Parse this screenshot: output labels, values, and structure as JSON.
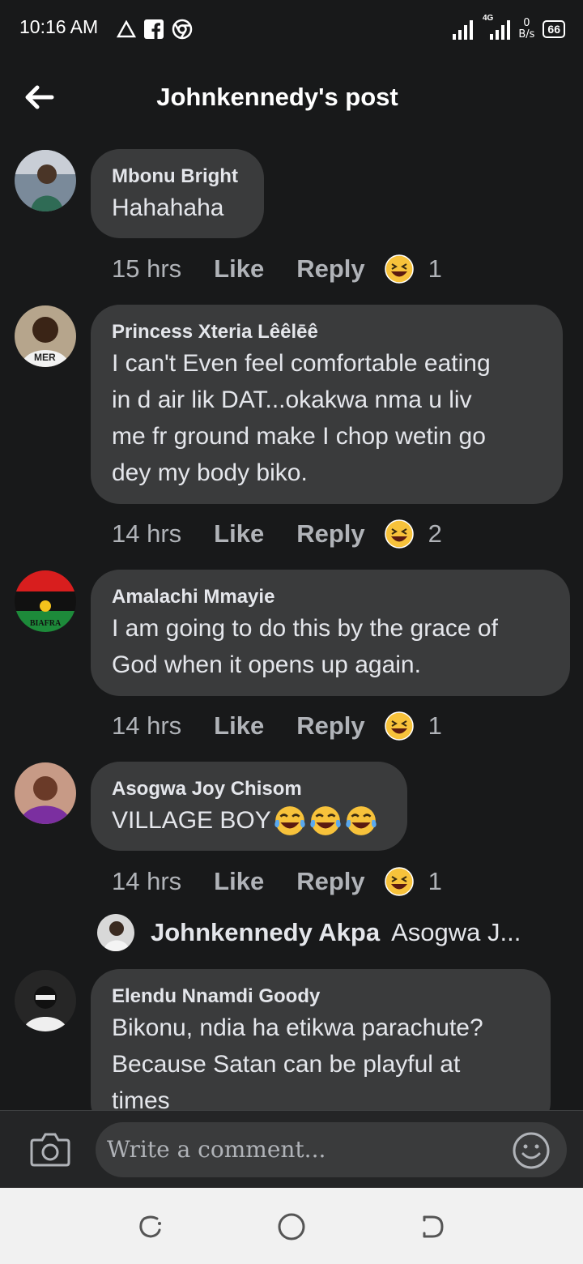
{
  "status_bar": {
    "time": "10:16 AM",
    "network": "4G",
    "speed_value": "0",
    "speed_unit": "B/s",
    "battery": "66"
  },
  "header": {
    "title": "Johnkennedy's post"
  },
  "comments": [
    {
      "name": "Mbonu Bright",
      "lines": [
        "Hahahaha"
      ],
      "time": "15 hrs",
      "like": "Like",
      "reply": "Reply",
      "reactions": "1"
    },
    {
      "name": "Princess Xteria Lêêlēê",
      "lines": [
        "I can't Even feel comfortable eating",
        "in d air lik DAT...okakwa nma u liv",
        "me fr ground make I chop wetin go",
        "dey my body biko."
      ],
      "time": "14 hrs",
      "like": "Like",
      "reply": "Reply",
      "reactions": "2"
    },
    {
      "name": "Amalachi Mmayie",
      "lines": [
        "I am going to do this by the grace of",
        "God when it opens up again."
      ],
      "time": "14 hrs",
      "like": "Like",
      "reply": "Reply",
      "reactions": "1",
      "avatar_text": "BIAFRA"
    },
    {
      "name": "Asogwa Joy Chisom",
      "lines": [
        "VILLAGE BOY"
      ],
      "time": "14 hrs",
      "like": "Like",
      "reply": "Reply",
      "reactions": "1"
    },
    {
      "name": "Elendu Nnamdi Goody",
      "lines": [
        "Bikonu, ndia ha etikwa parachute?",
        "Because Satan can be playful at",
        "times"
      ]
    }
  ],
  "reply_preview": {
    "name": "Johnkennedy Akpa",
    "text": "Asogwa J..."
  },
  "composer": {
    "placeholder": "Write a comment..."
  },
  "icons": [
    "back-arrow-icon",
    "camera-icon",
    "smile-icon",
    "laugh-react-icon",
    "recent-apps-icon",
    "home-icon",
    "back-nav-icon"
  ]
}
